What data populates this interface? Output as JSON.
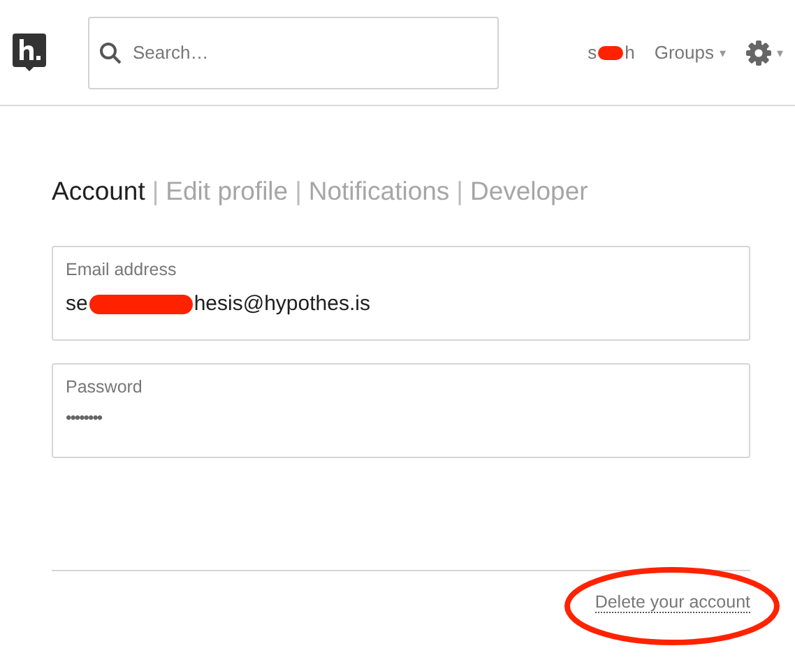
{
  "header": {
    "search": {
      "placeholder": "Search…"
    },
    "user": {
      "start": "s",
      "end": "h",
      "redacted": true
    },
    "groups": {
      "label": "Groups",
      "caret": "▾"
    },
    "settings": {
      "caret": "▾"
    }
  },
  "tabs": {
    "separator": "|",
    "items": [
      {
        "label": "Account",
        "selected": true
      },
      {
        "label": "Edit profile",
        "selected": false
      },
      {
        "label": "Notifications",
        "selected": false
      },
      {
        "label": "Developer",
        "selected": false
      }
    ]
  },
  "fields": [
    {
      "label": "Email address",
      "kind": "text",
      "start": "se",
      "end": "hesis@hypothes.is",
      "redacted": true
    },
    {
      "label": "Password",
      "kind": "password",
      "value": "••••••••"
    }
  ],
  "delete_link": {
    "label": "Delete your account",
    "circled": true
  }
}
